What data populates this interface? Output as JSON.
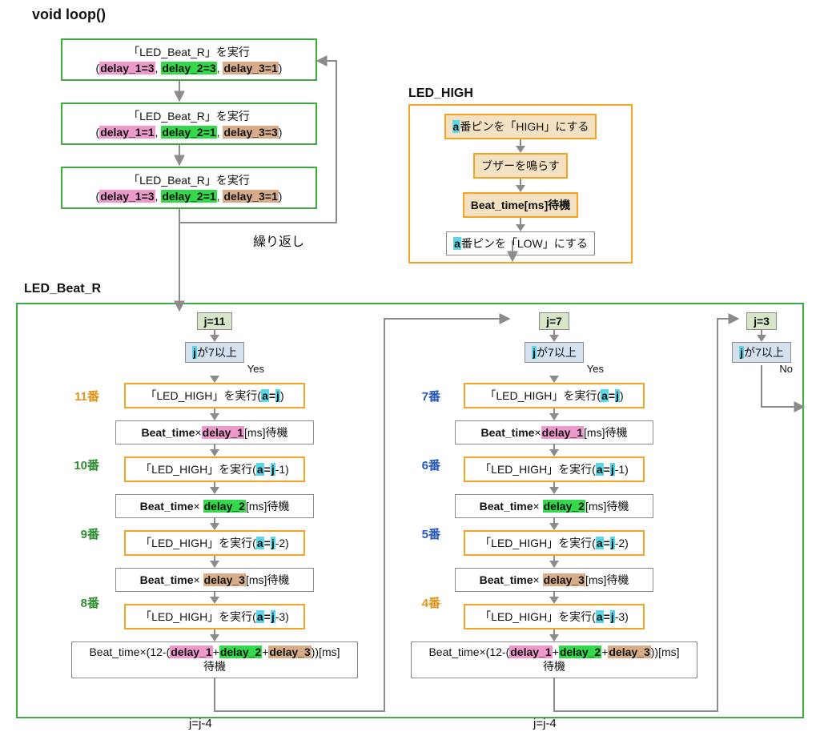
{
  "titles": {
    "voidloop": "void loop()",
    "led_high": "LED_HIGH",
    "led_beat_r": "LED_Beat_R",
    "repeat": "繰り返し"
  },
  "loop_calls": [
    {
      "header": "「LED_Beat_R」を実行",
      "d1_label": "delay_1=3",
      "d2_label": "delay_2=3",
      "d3_label": "delay_3=1"
    },
    {
      "header": "「LED_Beat_R」を実行",
      "d1_label": "delay_1=1",
      "d2_label": "delay_2=1",
      "d3_label": "delay_3=3"
    },
    {
      "header": "「LED_Beat_R」を実行",
      "d1_label": "delay_1=3",
      "d2_label": "delay_2=1",
      "d3_label": "delay_3=1"
    }
  ],
  "led_high_steps": {
    "s1_prefix": "a",
    "s1_rest": "番ピンを「HIGH」にする",
    "s2": "ブザーを鳴らす",
    "s3": "Beat_time[ms]待機",
    "s4_prefix": "a",
    "s4_rest": "番ピンを「LOW」にする"
  },
  "beatr_top": {
    "j_init_1": "j=11",
    "j_init_2": "j=7",
    "j_init_3": "j=3",
    "cond_j_prefix": "j",
    "cond_rest": "が7以上",
    "yes": "Yes",
    "no": "No",
    "loopupd": "j=j-4"
  },
  "side_labels": {
    "c1": [
      "11番",
      "10番",
      "9番",
      "8番"
    ],
    "c2": [
      "7番",
      "6番",
      "5番",
      "4番"
    ]
  },
  "exec_line": {
    "prefix": "「LED_HIGH」を実行(",
    "a": "a",
    "eq": "=",
    "j": "j",
    "v_minus1": "-1",
    "v_minus2": "-2",
    "v_minus3": "-3",
    "suffix": ")"
  },
  "wait": {
    "bt": "Beat_time",
    "mul": "×",
    "d1": "delay_1",
    "d2": "delay_2",
    "d3": "delay_3",
    "ms": "[ms]待機",
    "final_before": "Beat_time×(12-(",
    "final_mid1": "+",
    "final_mid2": "+",
    "final_after": "))[ms]",
    "final_wait": "待機"
  }
}
